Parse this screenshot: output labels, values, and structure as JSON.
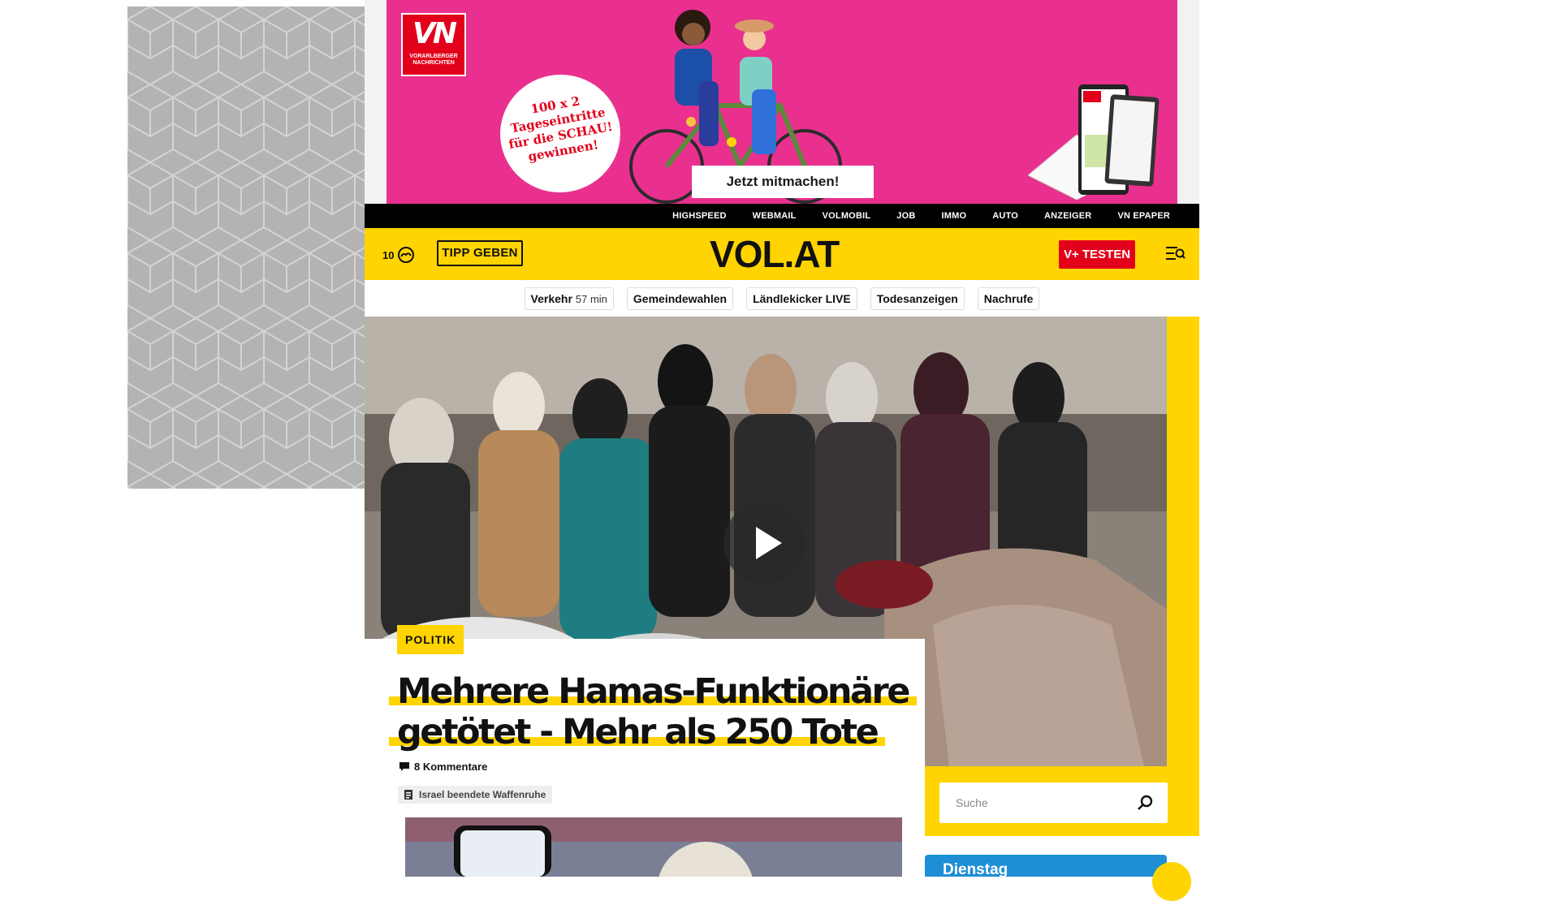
{
  "ad_banner": {
    "logo_text": "VN",
    "logo_subtext": "VORARLBERGER NACHRICHTEN",
    "promo_lines": [
      "100 x 2",
      "Tageseintritte",
      "für die SCHAU!",
      "gewinnen!"
    ],
    "cta_label": "Jetzt mitmachen!",
    "background_color": "#e9308f"
  },
  "service_bar": {
    "links": [
      "HIGHSPEED",
      "WEBMAIL",
      "VOLMOBIL",
      "JOB",
      "IMMO",
      "AUTO",
      "ANZEIGER",
      "VN EPAPER"
    ]
  },
  "header": {
    "temperature": "10",
    "weather_icon": "cloud-icon",
    "tipp_label": "TIPP GEBEN",
    "logo": "VOL.AT",
    "vplus_label": "V+ TESTEN",
    "menu_icon": "menu-search-icon",
    "accent_color": "#ffd400",
    "brand_red": "#e3001b"
  },
  "quick_links": [
    {
      "label": "Verkehr",
      "sub": "57 min"
    },
    {
      "label": "Gemeindewahlen",
      "sub": ""
    },
    {
      "label": "Ländlekicker LIVE",
      "sub": ""
    },
    {
      "label": "Todesanzeigen",
      "sub": ""
    },
    {
      "label": "Nachrufe",
      "sub": ""
    }
  ],
  "hero": {
    "play_icon": "play-icon",
    "category": "POLITIK",
    "headline": "Mehrere Hamas-Funktionäre getötet - Mehr als 250 Tote",
    "comments": "8 Kommentare",
    "topic_tag": "Israel beendete Waffenruhe"
  },
  "sidebar": {
    "search_placeholder": "Suche",
    "weather_day": "Dienstag"
  }
}
